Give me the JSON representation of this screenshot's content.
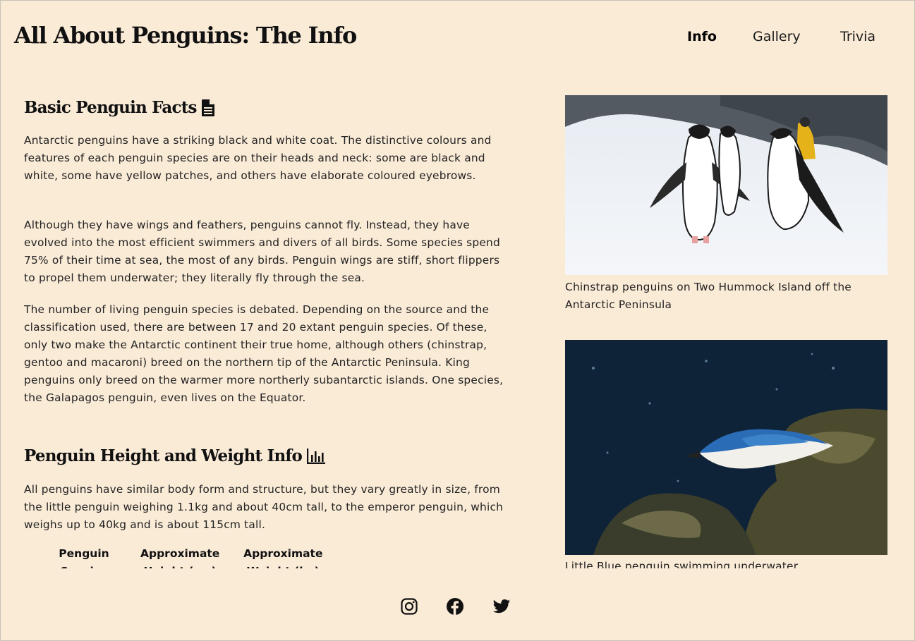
{
  "header": {
    "title": "All About Penguins: The Info",
    "nav": [
      {
        "label": "Info",
        "active": true
      },
      {
        "label": "Gallery",
        "active": false
      },
      {
        "label": "Trivia",
        "active": false
      }
    ]
  },
  "facts": {
    "heading": "Basic Penguin Facts",
    "heading_icon": "document-icon",
    "paragraphs": [
      "Antarctic penguins have a striking black and white coat. The distinctive colours and features of each penguin species are on their heads and neck: some are black and white, some have yellow patches, and others have elaborate coloured eyebrows.",
      "Although they have wings and feathers, penguins cannot fly. Instead, they have evolved into the most efficient swimmers and divers of all birds. Some species spend 75% of their time at sea, the most of any birds. Penguin wings are stiff, short flippers to propel them underwater; they literally fly through the sea.",
      "The number of living penguin species is debated. Depending on the source and the classification used, there are between 17 and 20 extant penguin species. Of these, only two make the Antarctic continent their true home, although others (chinstrap, gentoo and macaroni) breed on the northern tip of the Antarctic Peninsula. King penguins only breed on the warmer more northerly subantarctic islands. One species, the Galapagos penguin, even lives on the Equator."
    ]
  },
  "size": {
    "heading": "Penguin Height and Weight Info",
    "heading_icon": "bar-chart-icon",
    "paragraph": "All penguins have similar body form and structure, but they vary greatly in size, from the little penguin weighing 1.1kg and about 40cm tall, to the emperor penguin, which weighs up to 40kg and is about 115cm tall.",
    "table_headers": [
      "Penguin Species",
      "Approximate Height (cm)",
      "Approximate Weight (kg)"
    ]
  },
  "photos": [
    {
      "caption": "Chinstrap penguins on Two Hummock Island off the Antarctic Peninsula"
    },
    {
      "caption": "Little Blue penguin swimming underwater"
    }
  ],
  "footer": {
    "social": [
      "instagram-icon",
      "facebook-icon",
      "twitter-icon"
    ]
  },
  "colors": {
    "background": "#faebd7",
    "text": "#1a1a1a"
  }
}
